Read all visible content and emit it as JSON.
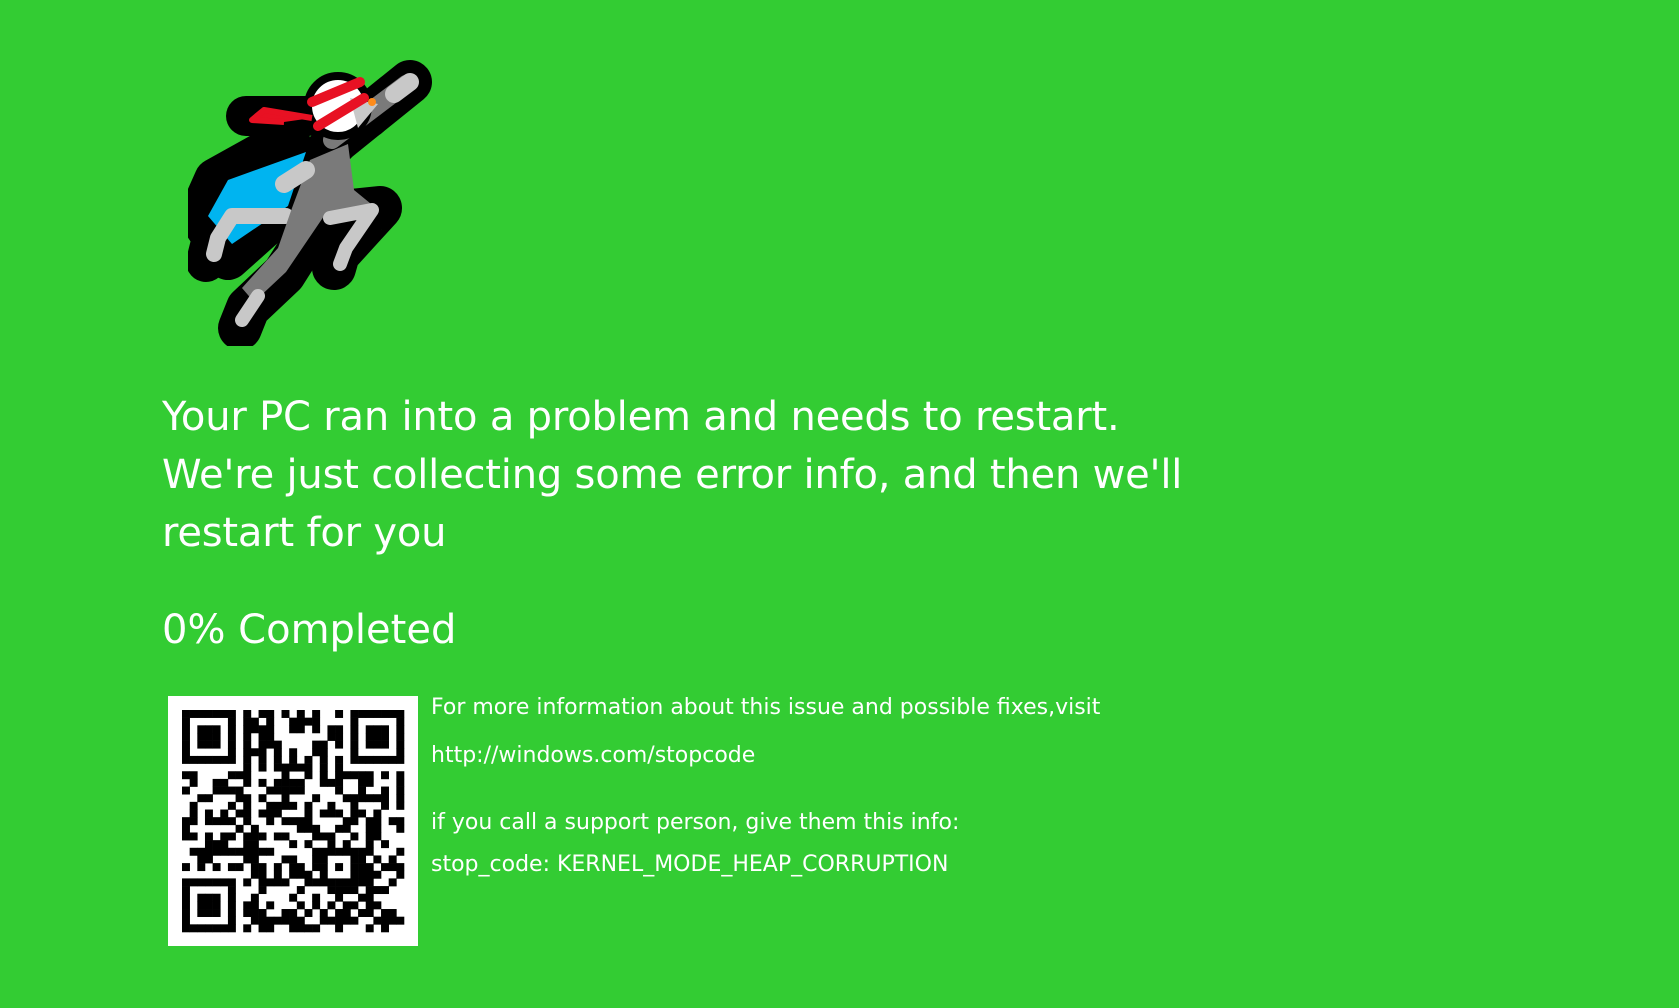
{
  "window": {
    "background_color": "#33cc33",
    "text_color": "#ffffff"
  },
  "illustration": {
    "icon": "flying-superhero-cat-icon",
    "colors": {
      "outline": "#000000",
      "body": "#7a7a7a",
      "light": "#c8c8c8",
      "headband": "#e81123",
      "cape": "#00b4f0"
    }
  },
  "message": {
    "text": "Your PC ran into a problem and needs to restart. We're just collecting some error info, and then we'll restart for you"
  },
  "progress": {
    "percent": 0,
    "text": "0% Completed"
  },
  "qr_code": {
    "icon": "qr-code-icon"
  },
  "info": {
    "more_info": "For more information about this issue and possible fixes,visit",
    "url": "http://windows.com/stopcode",
    "support_prompt": "if you call a support person, give them this info:",
    "stop_code": "stop_code: KERNEL_MODE_HEAP_CORRUPTION"
  }
}
